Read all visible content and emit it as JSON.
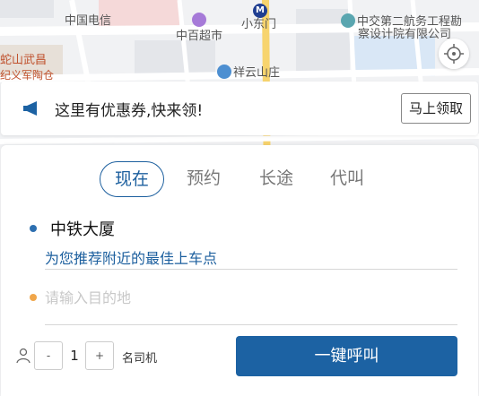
{
  "map": {
    "pois": [
      {
        "label": "中国电信",
        "icon": null
      },
      {
        "label": "中百超市",
        "icon": "shop-icon"
      },
      {
        "label": "小东门",
        "icon": "metro-icon"
      },
      {
        "label": "中交第二航务工程勘",
        "icon": "office-icon"
      },
      {
        "label": "察设计院有限公司",
        "icon": null
      },
      {
        "label": "蛇山武昌",
        "icon": null
      },
      {
        "label": "纪义军陶仓",
        "icon": null
      },
      {
        "label": "祥云山庄",
        "icon": "hotel-icon"
      }
    ],
    "metro_glyph": "M",
    "colors": {
      "road": "#ffffff",
      "major_road": "#f7d46e",
      "block": "#e6e8eb",
      "park": "#d3ecd8",
      "water": "#c9dcf3",
      "accent": "#1c62a3"
    }
  },
  "coupon": {
    "text": "这里有优惠券,快来领!",
    "button": "马上领取",
    "icon": "megaphone-icon"
  },
  "tabs": [
    {
      "label": "现在",
      "active": true
    },
    {
      "label": "预约",
      "active": false
    },
    {
      "label": "长途",
      "active": false
    },
    {
      "label": "代叫",
      "active": false
    }
  ],
  "start": {
    "name": "中铁大厦",
    "hint": "为您推荐附近的最佳上车点"
  },
  "destination": {
    "placeholder": "请输入目的地",
    "value": ""
  },
  "drivers": {
    "minus": "-",
    "count": "1",
    "plus": "+",
    "label": "名司机",
    "icon": "person-icon"
  },
  "call_button": "一键呼叫"
}
